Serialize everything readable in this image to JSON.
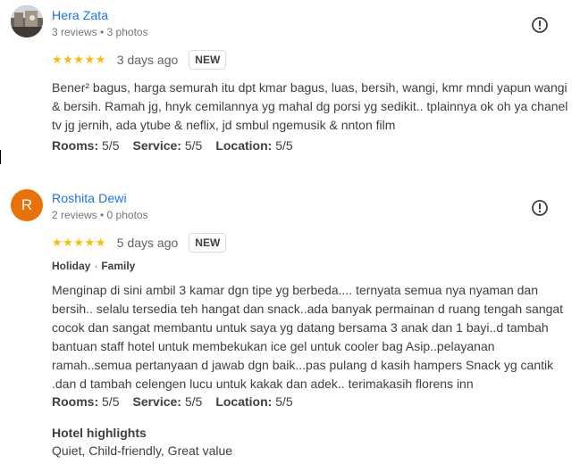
{
  "reviews": [
    {
      "name": "Hera Zata",
      "meta": "3 reviews • 3 photos",
      "stars": "★★★★★",
      "date": "3 days ago",
      "badge": "NEW",
      "text": "Bener² bagus, harga semurah itu dpt kmar bagus, luas, bersih, wangi, kmr mndi yapun wangi\n& bersih. Ramah jg, hnyk cemilannya yg mahal dg porsi yg sedikit.. tplainnya ok oh ya chanel\ntv jg jernih, ada ytube & neflix, jd smbul ngemusik & nnton film",
      "ratings": [
        {
          "label": "Rooms:",
          "value": "5/5"
        },
        {
          "label": "Service:",
          "value": "5/5"
        },
        {
          "label": "Location:",
          "value": "5/5"
        }
      ]
    },
    {
      "name": "Roshita Dewi",
      "avatar_letter": "R",
      "meta": "2 reviews • 0 photos",
      "stars": "★★★★★",
      "date": "5 days ago",
      "badge": "NEW",
      "trip": [
        "Holiday",
        "Family"
      ],
      "trip_sep": "·",
      "text": "Menginap di sini ambil 3 kamar dgn tipe yg berbeda.... ternyata semua nya nyaman dan\nbersih.. selalu tersedia teh hangat dan snack..ada banyak permainan d ruang tengah sangat\ncocok dan sangat membantu untuk saya yg datang bersama 3 anak dan 1 bayi..d tambah\nbantuan staff hotel untuk membekukan ice gel untuk cooler bag Asip..pelayanan\nramah..semua pertanyaan d jawab dgn baik...pas pulang d kasih hampers Snack yg cantik\n.dan d tambah celengen lucu untuk kakak dan adek.. terimakasih florens inn",
      "ratings": [
        {
          "label": "Rooms:",
          "value": "5/5"
        },
        {
          "label": "Service:",
          "value": "5/5"
        },
        {
          "label": "Location:",
          "value": "5/5"
        }
      ],
      "highlights_title": "Hotel highlights",
      "highlights": "Quiet, Child-friendly, Great value"
    }
  ],
  "colors": {
    "name_link": "#1a73e8",
    "star": "#fbbc04",
    "avatar_r": "#e8710a"
  },
  "icons": [
    "report-icon"
  ]
}
